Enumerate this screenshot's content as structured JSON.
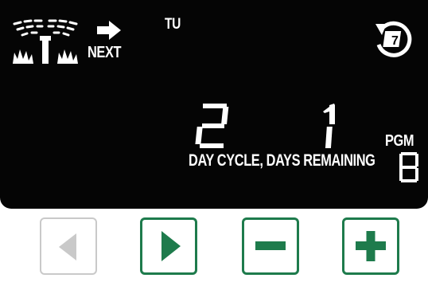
{
  "display": {
    "day": "TU",
    "next_label": "NEXT",
    "cycle_value": "2",
    "days_remaining_value": "1",
    "cycle_label": "DAY CYCLE, DAYS REMAINING",
    "pgm_label": "PGM",
    "program": "B"
  },
  "icons": {
    "sprinkler": "sprinkler-icon",
    "next_arrow": "arrow-right-icon",
    "calendar_cycle": "calendar-cycle-icon"
  },
  "buttons": [
    {
      "name": "back-button",
      "icon": "triangle-left-icon",
      "enabled": false
    },
    {
      "name": "forward-button",
      "icon": "triangle-right-icon",
      "enabled": true
    },
    {
      "name": "minus-button",
      "icon": "minus-icon",
      "enabled": true
    },
    {
      "name": "plus-button",
      "icon": "plus-icon",
      "enabled": true
    }
  ],
  "colors": {
    "lcd_background": "#050505",
    "lcd_text": "#ffffff",
    "button_green": "#1e7b4c",
    "button_disabled": "#c9c9c9"
  }
}
